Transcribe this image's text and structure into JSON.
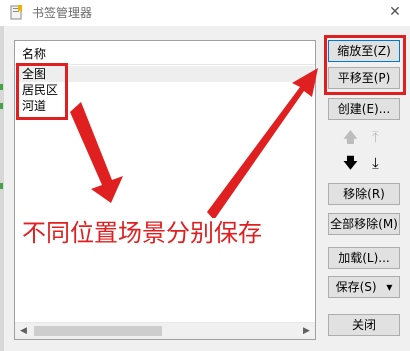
{
  "window": {
    "title": "书签管理器",
    "close_glyph": "✕"
  },
  "list": {
    "column_header": "名称",
    "items": [
      "全图",
      "居民区",
      "河道"
    ]
  },
  "buttons": {
    "zoom_to": "缩放至(Z)",
    "pan_to": "平移至(P)",
    "create": "创建(E)...",
    "remove": "移除(R)",
    "remove_all": "全部移除(M)",
    "load": "加载(L)...",
    "save": "保存(S)",
    "save_dropdown_glyph": "▾",
    "close": "关闭"
  },
  "order_arrows": {
    "move_up": "🡅",
    "move_top": "⤒",
    "move_down": "🡇",
    "move_bottom": "⤓"
  },
  "annotation": {
    "text": "不同位置场景分别保存",
    "color": "#e02020"
  }
}
